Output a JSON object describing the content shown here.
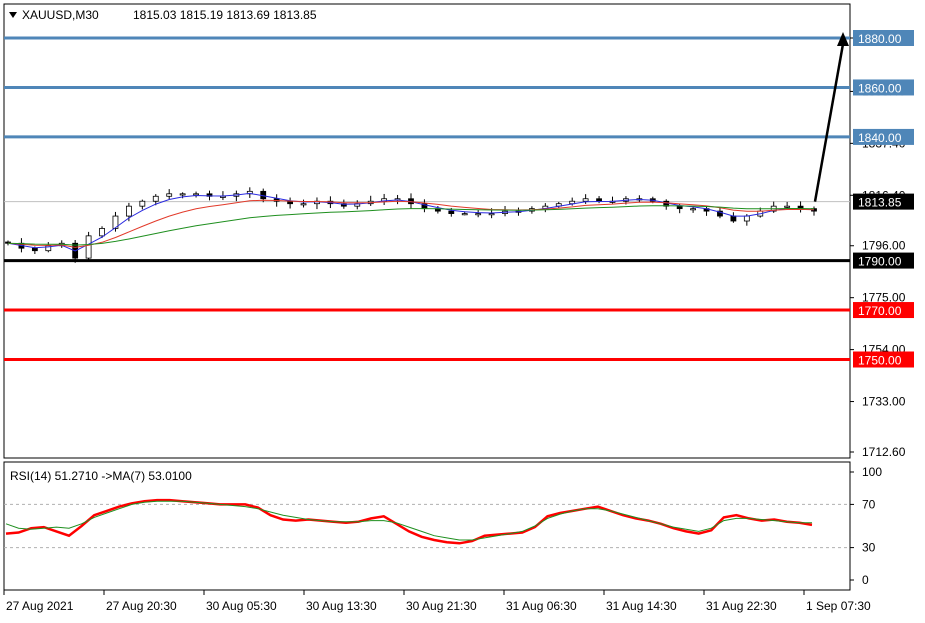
{
  "header": {
    "symbol": "XAUUSD,M30",
    "ohlc": "1815.03 1815.19 1813.69 1813.85"
  },
  "colors": {
    "blue_level": "#4f86b8",
    "red_level": "#ff0000",
    "black_level": "#000000",
    "ma_fast": "#2a2ae0",
    "ma_mid": "#e23a2a",
    "ma_slow": "#1f8f1f",
    "rsi": "#ff0000",
    "rsi_ma": "#1f8f1f"
  },
  "chart_data": [
    {
      "type": "candlestick",
      "ylim": [
        1712.6,
        1895
      ],
      "y_tick_labels": [
        "1712.60",
        "1733.00",
        "1754.00",
        "1775.00",
        "1796.00",
        "1816.40",
        "1837.40",
        "1858.40",
        "1880.00"
      ],
      "level_lines": [
        {
          "value": 1880.0,
          "label": "1880.00",
          "color": "blue"
        },
        {
          "value": 1860.0,
          "label": "1860.00",
          "color": "blue"
        },
        {
          "value": 1840.0,
          "label": "1840.00",
          "color": "blue"
        },
        {
          "value": 1790.0,
          "label": "1790.00",
          "color": "black"
        },
        {
          "value": 1770.0,
          "label": "1770.00",
          "color": "red"
        },
        {
          "value": 1750.0,
          "label": "1750.00",
          "color": "red"
        }
      ],
      "current_price": {
        "value": 1813.85,
        "label": "1813.85"
      },
      "closes": [
        1797,
        1795,
        1794,
        1796,
        1797,
        1791,
        1800,
        1803,
        1808,
        1812,
        1814,
        1816,
        1817,
        1817,
        1817,
        1816,
        1816,
        1817,
        1818,
        1815,
        1814,
        1813,
        1813,
        1814,
        1813,
        1812,
        1813,
        1814,
        1815,
        1815,
        1813,
        1811,
        1810,
        1809,
        1809,
        1809,
        1809,
        1810,
        1810,
        1811,
        1812,
        1813,
        1814,
        1815,
        1814,
        1814,
        1815,
        1815,
        1814,
        1812,
        1811,
        1811,
        1810,
        1808,
        1806,
        1808,
        1810,
        1812,
        1812,
        1811,
        1810
      ],
      "projection": {
        "from": 1813.85,
        "to": 1880.0
      }
    },
    {
      "type": "line",
      "title": "RSI(14) 51.2710  ->MA(7) 53.0100",
      "ylim": [
        0,
        100
      ],
      "y_tick_labels": [
        "0",
        "30",
        "70",
        "100"
      ],
      "levels": [
        30,
        70
      ],
      "series": [
        {
          "name": "RSI(14)",
          "values": [
            43,
            44,
            48,
            49,
            45,
            41,
            50,
            60,
            64,
            68,
            71,
            73,
            74,
            74,
            73,
            72,
            71,
            70,
            70,
            70,
            67,
            60,
            56,
            55,
            56,
            55,
            54,
            53,
            54,
            57,
            59,
            52,
            45,
            40,
            37,
            35,
            34,
            36,
            41,
            42,
            43,
            44,
            49,
            59,
            62,
            64,
            66,
            68,
            64,
            60,
            57,
            55,
            52,
            48,
            45,
            43,
            46,
            58,
            60,
            57,
            55,
            56,
            54,
            53,
            51
          ]
        },
        {
          "name": "MA(7)",
          "values": [
            52,
            48,
            47,
            48,
            49,
            48,
            52,
            58,
            62,
            66,
            70,
            72,
            73,
            73,
            73,
            72,
            71,
            70,
            69,
            68,
            66,
            63,
            60,
            58,
            56,
            55,
            54,
            54,
            54,
            55,
            55,
            53,
            49,
            45,
            41,
            39,
            37,
            37,
            39,
            41,
            43,
            45,
            50,
            57,
            61,
            64,
            66,
            66,
            64,
            61,
            58,
            55,
            52,
            49,
            47,
            45,
            48,
            55,
            57,
            57,
            56,
            55,
            54,
            53,
            53
          ]
        }
      ]
    }
  ],
  "x_axis_labels": [
    "27 Aug 2021",
    "27 Aug 20:30",
    "30 Aug 05:30",
    "30 Aug 13:30",
    "30 Aug 21:30",
    "31 Aug 06:30",
    "31 Aug 14:30",
    "31 Aug 22:30",
    "1 Sep 07:30"
  ]
}
